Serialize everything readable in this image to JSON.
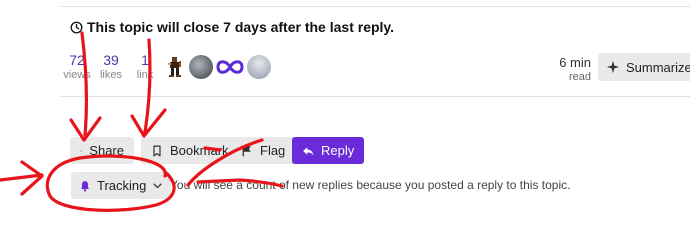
{
  "topic_timer": {
    "text": "This topic will close 7 days after the last reply."
  },
  "stats": {
    "views": {
      "value": "72",
      "label": "views"
    },
    "likes": {
      "value": "39",
      "label": "likes"
    },
    "links": {
      "value": "1",
      "label": "link"
    }
  },
  "participants": [
    {
      "name": "pixel-sprite-avatar"
    },
    {
      "name": "masked-photo-avatar"
    },
    {
      "name": "infinity-loop-avatar"
    },
    {
      "name": "portrait-avatar"
    }
  ],
  "read_time": {
    "value": "6 min",
    "label": "read"
  },
  "summarize": {
    "label": "Summarize",
    "icon": "sparkle-icon"
  },
  "actions": {
    "share": {
      "label": "Share",
      "icon": "link-icon"
    },
    "bookmark": {
      "label": "Bookmark",
      "icon": "bookmark-icon"
    },
    "flag": {
      "label": "Flag",
      "icon": "flag-icon"
    },
    "reply": {
      "label": "Reply",
      "icon": "reply-icon"
    }
  },
  "notifications": {
    "level": "Tracking",
    "icon": "bell-icon",
    "description": "You will see a count of new replies because you posted a reply to this topic."
  },
  "colors": {
    "accent": "#6b2bd9",
    "stat_number": "#4a3aaa",
    "annotation": "#e8141b"
  }
}
